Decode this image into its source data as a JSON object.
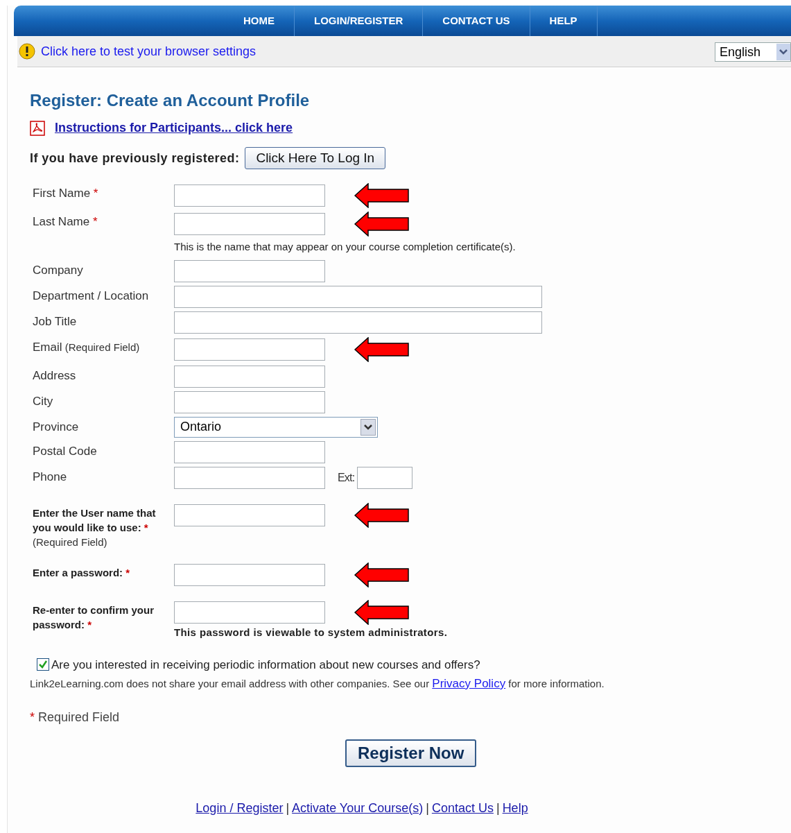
{
  "nav": [
    {
      "label": "HOME",
      "selected": false
    },
    {
      "label": "LOGIN/REGISTER",
      "selected": false
    },
    {
      "label": "CONTACT US",
      "selected": false
    },
    {
      "label": "HELP",
      "selected": false
    }
  ],
  "notice": {
    "link": "Click here to test your browser settings"
  },
  "language": {
    "value": "English"
  },
  "page_title": "Register: Create an Account Profile",
  "instructions_link": "Instructions for Participants... click here",
  "login_prompt": {
    "label": "If you have previously registered:",
    "button": "Click Here To Log In"
  },
  "fields": [
    {
      "label": "First Name",
      "required": true,
      "bold": false,
      "kind": "short",
      "arrow": true
    },
    {
      "label": "Last Name",
      "required": true,
      "bold": false,
      "kind": "short",
      "arrow": true,
      "hint": "This is the name that may appear on your course completion certificate(s)."
    },
    {
      "label": "Company",
      "required": false,
      "bold": false,
      "kind": "short",
      "arrow": false
    },
    {
      "label": "Department / Location",
      "required": false,
      "bold": false,
      "kind": "wide",
      "arrow": false
    },
    {
      "label": "Job Title",
      "required": false,
      "bold": false,
      "kind": "wide",
      "arrow": false
    },
    {
      "label": "Email",
      "inline_note": "(Required Field)",
      "required": false,
      "bold": false,
      "kind": "short",
      "arrow": true
    },
    {
      "label": "Address",
      "required": false,
      "bold": false,
      "kind": "short",
      "arrow": false
    },
    {
      "label": "City",
      "required": false,
      "bold": false,
      "kind": "short",
      "arrow": false
    },
    {
      "label": "Province",
      "required": false,
      "bold": false,
      "kind": "select",
      "value": "Ontario",
      "arrow": false
    },
    {
      "label": "Postal Code",
      "required": false,
      "bold": false,
      "kind": "short",
      "arrow": false
    },
    {
      "label": "Phone",
      "required": false,
      "bold": false,
      "kind": "phone",
      "ext_label": "Ext:",
      "arrow": false
    },
    {
      "label": "Enter the User name that you would like to use:",
      "note": "(Required Field)",
      "required": true,
      "bold": true,
      "kind": "short",
      "arrow": true
    },
    {
      "label": "Enter a password:",
      "required": true,
      "bold": true,
      "kind": "short",
      "arrow": true
    },
    {
      "label": "Re-enter to confirm your password:",
      "required": true,
      "bold": true,
      "kind": "short",
      "arrow": true,
      "bold_hint": "This password is viewable to system administrators."
    }
  ],
  "newsletter": {
    "checked": true,
    "label": "Are you interested in receiving periodic information about new courses and offers?",
    "privacy_before": "Link2eLearning.com does not share your email address with other companies. See our",
    "privacy_link": "Privacy Policy",
    "privacy_after": "for more information."
  },
  "required_legend": {
    "mark": "*",
    "text": "Required Field"
  },
  "submit": "Register Now",
  "footer_links": [
    "Login / Register",
    "Activate Your Course(s)",
    "Contact Us",
    "Help"
  ],
  "footer_separators": [
    "|",
    "|",
    "|"
  ]
}
